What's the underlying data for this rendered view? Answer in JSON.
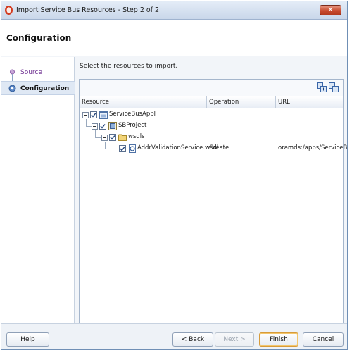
{
  "window": {
    "title": "Import Service Bus Resources - Step 2 of 2"
  },
  "header": {
    "title": "Configuration"
  },
  "nav": {
    "items": [
      {
        "label": "Source",
        "state": "visited"
      },
      {
        "label": "Configuration",
        "state": "current"
      }
    ]
  },
  "main": {
    "instruction": "Select the resources to import.",
    "columns": {
      "resource": "Resource",
      "operation": "Operation",
      "url": "URL"
    },
    "rows": [
      {
        "name": "ServiceBusAppl",
        "operation": "",
        "url": "",
        "checked": true,
        "icon": "application-icon"
      },
      {
        "name": "SBProject",
        "operation": "",
        "url": "",
        "checked": true,
        "icon": "project-icon"
      },
      {
        "name": "wsdls",
        "operation": "",
        "url": "",
        "checked": true,
        "icon": "folder-icon"
      },
      {
        "name": "AddrValidationService.wsdl",
        "operation": "Create",
        "url": "oramds:/apps/ServiceBus/...",
        "checked": true,
        "icon": "wsdl-icon"
      }
    ]
  },
  "footer": {
    "help": "Help",
    "back": "< Back",
    "next": "Next >",
    "finish": "Finish",
    "cancel": "Cancel"
  },
  "colors": {
    "accent": "#c84a2e",
    "nav_selected": "#dfe8f4",
    "link": "#6b2c8f"
  }
}
